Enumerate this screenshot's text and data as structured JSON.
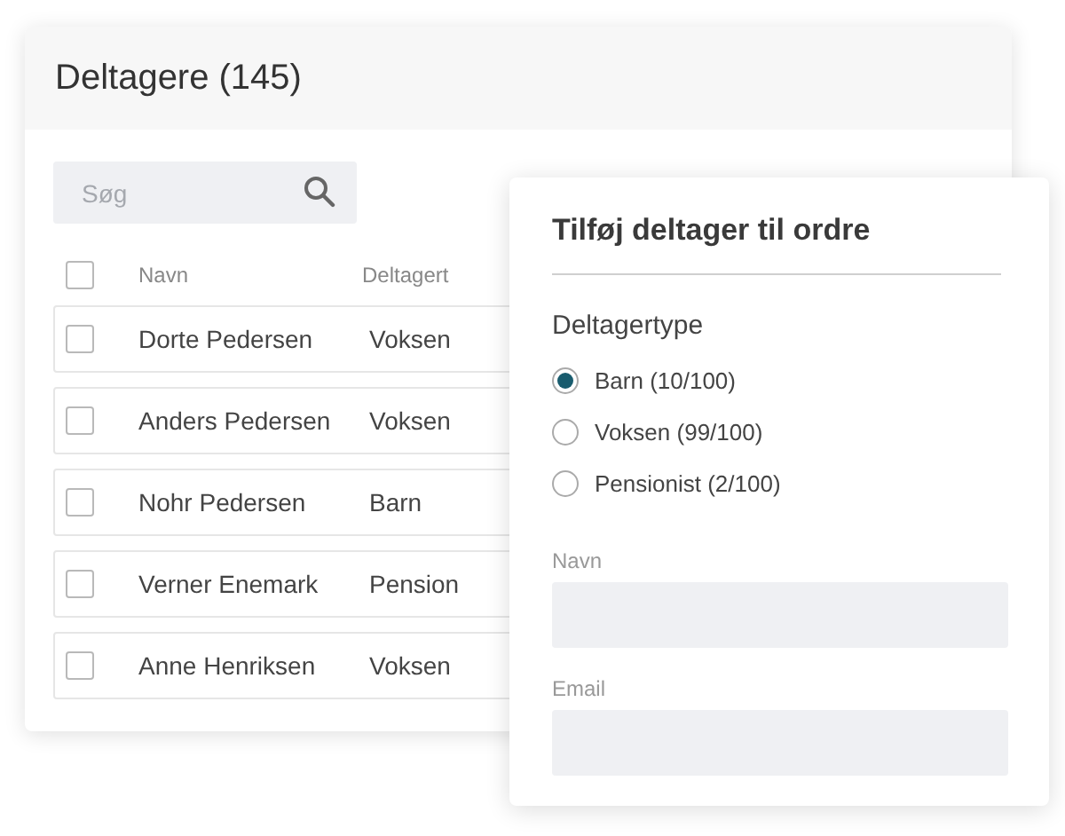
{
  "participants_card": {
    "title": "Deltagere (145)",
    "search": {
      "placeholder": "Søg"
    },
    "columns": [
      "Navn",
      "Deltagert"
    ],
    "header_checked": false,
    "rows": [
      {
        "name": "Dorte Pedersen",
        "type": "Voksen",
        "checked": false
      },
      {
        "name": "Anders Pedersen",
        "type": "Voksen",
        "checked": false
      },
      {
        "name": "Nohr Pedersen",
        "type": "Barn",
        "checked": false
      },
      {
        "name": "Verner Enemark",
        "type": "Pension",
        "checked": false
      },
      {
        "name": "Anne Henriksen",
        "type": "Voksen",
        "checked": false
      }
    ]
  },
  "add_dialog": {
    "title": "Tilføj deltager til ordre",
    "type_label": "Deltagertype",
    "options": [
      {
        "label": "Barn (10/100)",
        "selected": true
      },
      {
        "label": "Voksen (99/100)",
        "selected": false
      },
      {
        "label": "Pensionist (2/100)",
        "selected": false
      }
    ],
    "fields": [
      {
        "label": "Navn"
      },
      {
        "label": "Email"
      }
    ]
  }
}
